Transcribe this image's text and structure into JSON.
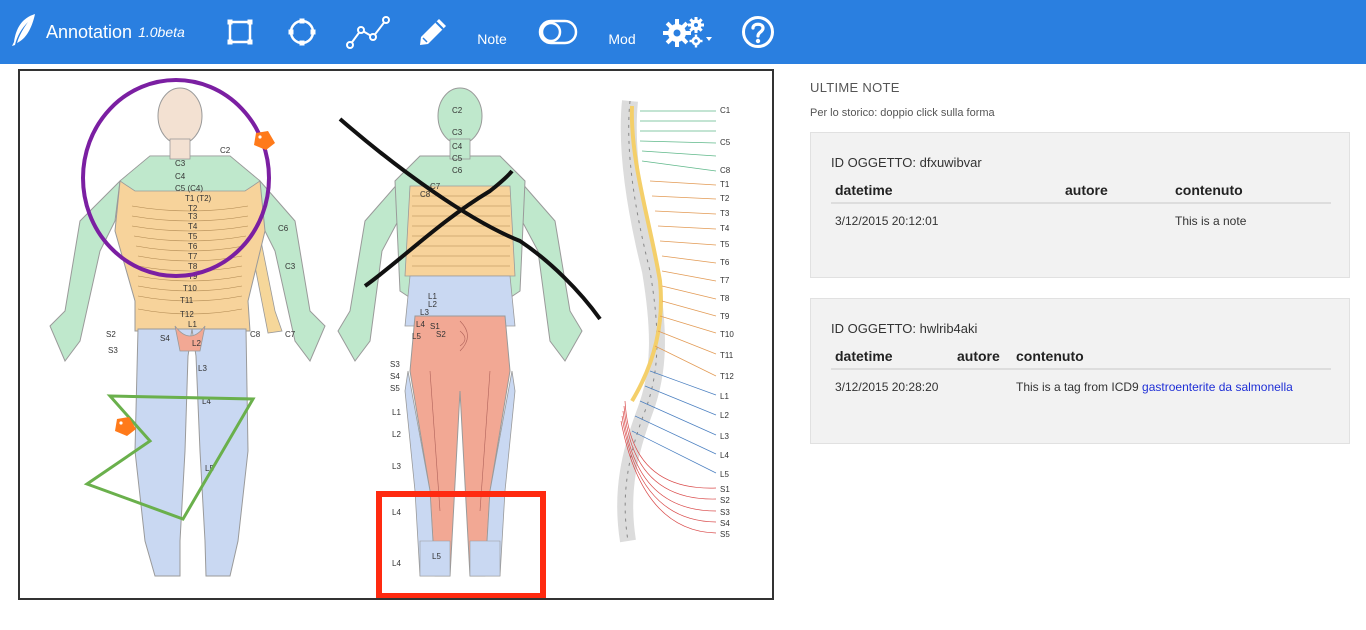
{
  "app": {
    "name": "Annotation",
    "version": "1.0beta",
    "logo_icon": "feather-icon",
    "accent_color": "#2a7fe0"
  },
  "toolbar": {
    "rectangle_icon": "rectangle-tool-icon",
    "circle_icon": "circle-tool-icon",
    "polyline_icon": "polyline-tool-icon",
    "pencil_icon": "pencil-tool-icon",
    "note_label": "Note",
    "toggle_icon": "toggle-icon",
    "mod_label": "Mod",
    "settings_icon": "gears-icon",
    "help_icon": "help-icon"
  },
  "canvas": {
    "labels_front": [
      "C2",
      "C3",
      "C4",
      "C5 (C4)",
      "T1 (T2)",
      "T2",
      "T3",
      "T4",
      "T5",
      "T6",
      "T7",
      "T8",
      "T9",
      "T10",
      "T11",
      "T12",
      "L1",
      "L2",
      "L3",
      "L4",
      "L5",
      "S2",
      "S3",
      "S4",
      "C6",
      "C3",
      "C8",
      "C7"
    ],
    "labels_back": [
      "C2",
      "C3",
      "C4",
      "C5",
      "C6",
      "C7",
      "C8",
      "L1",
      "L2",
      "L3",
      "L4",
      "L5",
      "S1",
      "S2",
      "S3",
      "S4",
      "S5",
      "L1",
      "L2",
      "L3",
      "L4",
      "L5",
      "L4"
    ],
    "labels_spine": [
      "C1",
      "C5",
      "C8",
      "T1",
      "T2",
      "T3",
      "T4",
      "T5",
      "T6",
      "T7",
      "T8",
      "T9",
      "T10",
      "T11",
      "T12",
      "L1",
      "L2",
      "L3",
      "L4",
      "L5",
      "S1",
      "S2",
      "S3",
      "S4",
      "S5"
    ],
    "annotation_colors": {
      "circle": "#7b1fa2",
      "cross": "#111111",
      "triangle": "#6ab04c",
      "rectangle": "#ff2a10",
      "tag": "#ff7a1a"
    }
  },
  "panel": {
    "title": "ULTIME NOTE",
    "hint": "Per lo storico: doppio click sulla forma",
    "notes": [
      {
        "id_label": "ID OGGETTO: dfxuwibvar",
        "headers": [
          "datetime",
          "autore",
          "contenuto"
        ],
        "rows": [
          {
            "datetime": "3/12/2015 20:12:01",
            "autore": "",
            "contenuto": "This is a note",
            "link": ""
          }
        ]
      },
      {
        "id_label": "ID OGGETTO: hwlrib4aki",
        "headers": [
          "datetime",
          "autore",
          "contenuto"
        ],
        "rows": [
          {
            "datetime": "3/12/2015 20:28:20",
            "autore": "",
            "contenuto": "This is a tag from ICD9 ",
            "link": "gastroenterite da salmonella"
          }
        ]
      }
    ]
  }
}
